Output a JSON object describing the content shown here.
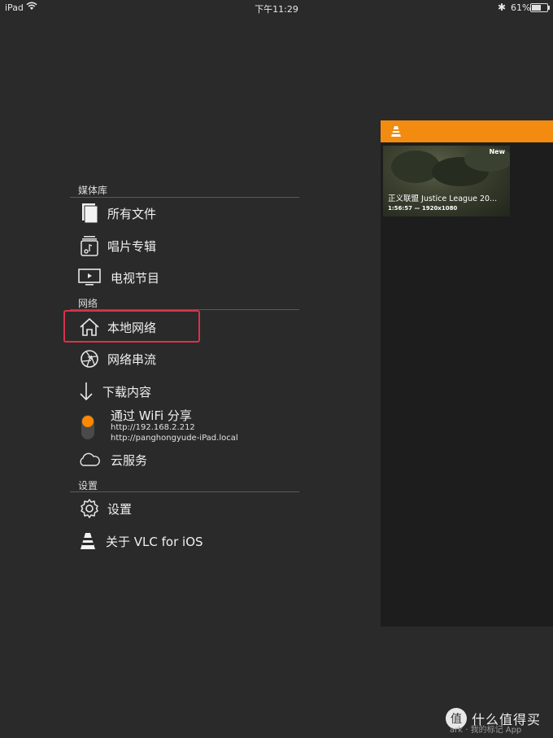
{
  "status_bar": {
    "device": "iPad",
    "time": "下午11:29",
    "battery": "61%",
    "battery_level": 0.61
  },
  "menu": {
    "section_media": "媒体库",
    "all_files": "所有文件",
    "albums": "唱片专辑",
    "tv_shows": "电视节目",
    "section_network": "网络",
    "local_network": "本地网络",
    "network_stream": "网络串流",
    "downloads": "下载内容",
    "wifi_share": "通过 WiFi 分享",
    "wifi_url_ip": "http://192.168.2.212",
    "wifi_url_host": "http://panghongyude-iPad.local",
    "cloud": "云服务",
    "section_settings": "设置",
    "settings": "设置",
    "about": "关于 VLC for iOS"
  },
  "panel": {
    "video": {
      "badge": "New",
      "title": "正义联盟 Justice League 20...",
      "meta": "1:56:57 — 1920x1080"
    }
  },
  "watermark": {
    "badge": "值",
    "text": "什么值得买",
    "small": "ark · 我的标记 App"
  },
  "colors": {
    "accent": "#f28b10",
    "background": "#2a2a2a",
    "highlight": "#d8334a"
  }
}
